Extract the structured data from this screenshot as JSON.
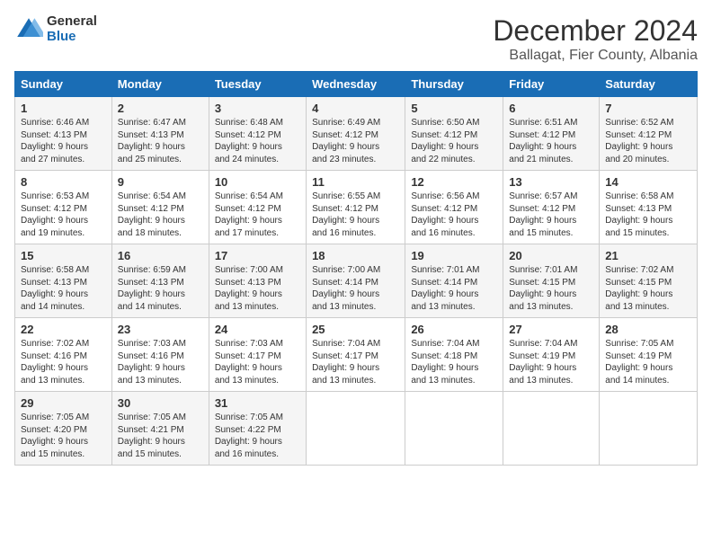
{
  "header": {
    "logo_general": "General",
    "logo_blue": "Blue",
    "month_title": "December 2024",
    "location": "Ballagat, Fier County, Albania"
  },
  "weekdays": [
    "Sunday",
    "Monday",
    "Tuesday",
    "Wednesday",
    "Thursday",
    "Friday",
    "Saturday"
  ],
  "weeks": [
    [
      {
        "day": "1",
        "info": "Sunrise: 6:46 AM\nSunset: 4:13 PM\nDaylight: 9 hours\nand 27 minutes."
      },
      {
        "day": "2",
        "info": "Sunrise: 6:47 AM\nSunset: 4:13 PM\nDaylight: 9 hours\nand 25 minutes."
      },
      {
        "day": "3",
        "info": "Sunrise: 6:48 AM\nSunset: 4:12 PM\nDaylight: 9 hours\nand 24 minutes."
      },
      {
        "day": "4",
        "info": "Sunrise: 6:49 AM\nSunset: 4:12 PM\nDaylight: 9 hours\nand 23 minutes."
      },
      {
        "day": "5",
        "info": "Sunrise: 6:50 AM\nSunset: 4:12 PM\nDaylight: 9 hours\nand 22 minutes."
      },
      {
        "day": "6",
        "info": "Sunrise: 6:51 AM\nSunset: 4:12 PM\nDaylight: 9 hours\nand 21 minutes."
      },
      {
        "day": "7",
        "info": "Sunrise: 6:52 AM\nSunset: 4:12 PM\nDaylight: 9 hours\nand 20 minutes."
      }
    ],
    [
      {
        "day": "8",
        "info": "Sunrise: 6:53 AM\nSunset: 4:12 PM\nDaylight: 9 hours\nand 19 minutes."
      },
      {
        "day": "9",
        "info": "Sunrise: 6:54 AM\nSunset: 4:12 PM\nDaylight: 9 hours\nand 18 minutes."
      },
      {
        "day": "10",
        "info": "Sunrise: 6:54 AM\nSunset: 4:12 PM\nDaylight: 9 hours\nand 17 minutes."
      },
      {
        "day": "11",
        "info": "Sunrise: 6:55 AM\nSunset: 4:12 PM\nDaylight: 9 hours\nand 16 minutes."
      },
      {
        "day": "12",
        "info": "Sunrise: 6:56 AM\nSunset: 4:12 PM\nDaylight: 9 hours\nand 16 minutes."
      },
      {
        "day": "13",
        "info": "Sunrise: 6:57 AM\nSunset: 4:12 PM\nDaylight: 9 hours\nand 15 minutes."
      },
      {
        "day": "14",
        "info": "Sunrise: 6:58 AM\nSunset: 4:13 PM\nDaylight: 9 hours\nand 15 minutes."
      }
    ],
    [
      {
        "day": "15",
        "info": "Sunrise: 6:58 AM\nSunset: 4:13 PM\nDaylight: 9 hours\nand 14 minutes."
      },
      {
        "day": "16",
        "info": "Sunrise: 6:59 AM\nSunset: 4:13 PM\nDaylight: 9 hours\nand 14 minutes."
      },
      {
        "day": "17",
        "info": "Sunrise: 7:00 AM\nSunset: 4:13 PM\nDaylight: 9 hours\nand 13 minutes."
      },
      {
        "day": "18",
        "info": "Sunrise: 7:00 AM\nSunset: 4:14 PM\nDaylight: 9 hours\nand 13 minutes."
      },
      {
        "day": "19",
        "info": "Sunrise: 7:01 AM\nSunset: 4:14 PM\nDaylight: 9 hours\nand 13 minutes."
      },
      {
        "day": "20",
        "info": "Sunrise: 7:01 AM\nSunset: 4:15 PM\nDaylight: 9 hours\nand 13 minutes."
      },
      {
        "day": "21",
        "info": "Sunrise: 7:02 AM\nSunset: 4:15 PM\nDaylight: 9 hours\nand 13 minutes."
      }
    ],
    [
      {
        "day": "22",
        "info": "Sunrise: 7:02 AM\nSunset: 4:16 PM\nDaylight: 9 hours\nand 13 minutes."
      },
      {
        "day": "23",
        "info": "Sunrise: 7:03 AM\nSunset: 4:16 PM\nDaylight: 9 hours\nand 13 minutes."
      },
      {
        "day": "24",
        "info": "Sunrise: 7:03 AM\nSunset: 4:17 PM\nDaylight: 9 hours\nand 13 minutes."
      },
      {
        "day": "25",
        "info": "Sunrise: 7:04 AM\nSunset: 4:17 PM\nDaylight: 9 hours\nand 13 minutes."
      },
      {
        "day": "26",
        "info": "Sunrise: 7:04 AM\nSunset: 4:18 PM\nDaylight: 9 hours\nand 13 minutes."
      },
      {
        "day": "27",
        "info": "Sunrise: 7:04 AM\nSunset: 4:19 PM\nDaylight: 9 hours\nand 13 minutes."
      },
      {
        "day": "28",
        "info": "Sunrise: 7:05 AM\nSunset: 4:19 PM\nDaylight: 9 hours\nand 14 minutes."
      }
    ],
    [
      {
        "day": "29",
        "info": "Sunrise: 7:05 AM\nSunset: 4:20 PM\nDaylight: 9 hours\nand 15 minutes."
      },
      {
        "day": "30",
        "info": "Sunrise: 7:05 AM\nSunset: 4:21 PM\nDaylight: 9 hours\nand 15 minutes."
      },
      {
        "day": "31",
        "info": "Sunrise: 7:05 AM\nSunset: 4:22 PM\nDaylight: 9 hours\nand 16 minutes."
      },
      null,
      null,
      null,
      null
    ]
  ]
}
